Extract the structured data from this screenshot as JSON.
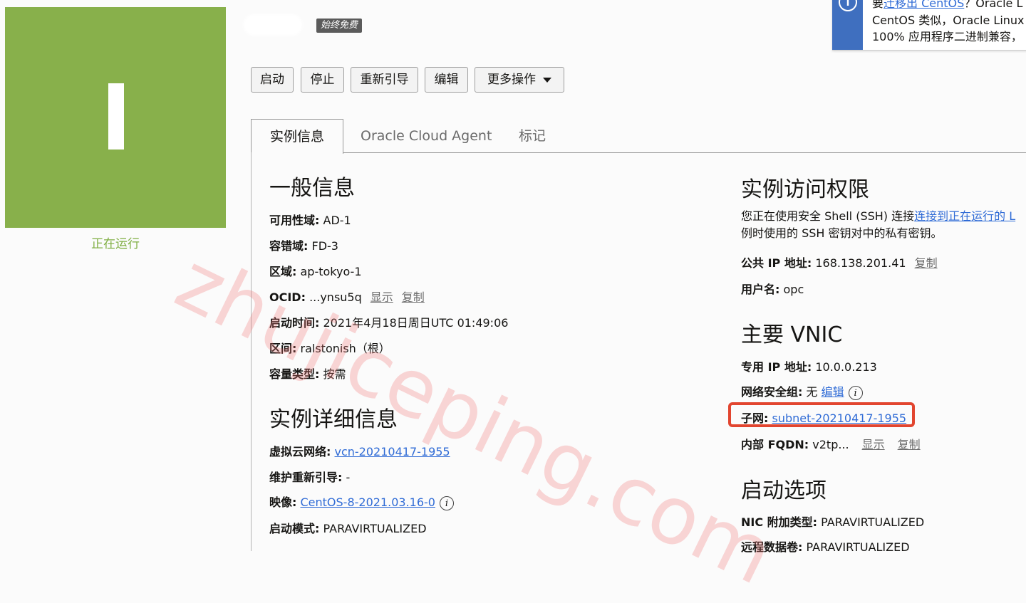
{
  "status": {
    "label": "正在运行",
    "color": "#88b04b"
  },
  "header": {
    "badge": "始终免费"
  },
  "banner": {
    "line1_prefix": "要",
    "line1_link": "迁移出 CentOS",
    "line1_suffix": "？Oracle L",
    "line2": "CentOS 类似，Oracle Linux",
    "line3": "100% 应用程序二进制兼容，"
  },
  "actions": {
    "start": "启动",
    "stop": "停止",
    "reboot": "重新引导",
    "edit": "编辑",
    "more": "更多操作"
  },
  "tabs": [
    "实例信息",
    "Oracle Cloud Agent",
    "标记"
  ],
  "general": {
    "title": "一般信息",
    "ad_label": "可用性域:",
    "ad_value": "AD-1",
    "fd_label": "容错域:",
    "fd_value": "FD-3",
    "region_label": "区域:",
    "region_value": "ap-tokyo-1",
    "ocid_label": "OCID:",
    "ocid_value": "...ynsu5q",
    "ocid_show": "显示",
    "ocid_copy": "复制",
    "launch_label": "启动时间:",
    "launch_value": "2021年4月18日周日UTC 01:49:06",
    "compartment_label": "区间:",
    "compartment_value": "ralstonish（根）",
    "capacity_label": "容量类型:",
    "capacity_value": "按需"
  },
  "details": {
    "title": "实例详细信息",
    "vcn_label": "虚拟云网络:",
    "vcn_value": "vcn-20210417-1955",
    "maint_label": "维护重新引导:",
    "maint_value": "-",
    "image_label": "映像:",
    "image_value": "CentOS-8-2021.03.16-0",
    "launch_mode_label": "启动模式:",
    "launch_mode_value": "PARAVIRTUALIZED"
  },
  "access": {
    "title": "实例访问权限",
    "desc1_prefix": "您正在使用安全 Shell (SSH) 连接",
    "desc1_link": "连接到正在运行的 L",
    "desc2": "例时使用的 SSH 密钥对中的私有密钥。",
    "public_ip_label": "公共 IP 地址:",
    "public_ip_value": "168.138.201.41",
    "public_ip_copy": "复制",
    "username_label": "用户名:",
    "username_value": "opc"
  },
  "vnic": {
    "title": "主要 VNIC",
    "private_ip_label": "专用 IP 地址:",
    "private_ip_value": "10.0.0.213",
    "nsg_label": "网络安全组:",
    "nsg_value": "无",
    "nsg_edit": "编辑",
    "subnet_label": "子网:",
    "subnet_value": "subnet-20210417-1955",
    "fqdn_label": "内部 FQDN:",
    "fqdn_value": "v2tp...",
    "fqdn_show": "显示",
    "fqdn_copy": "复制"
  },
  "launch_options": {
    "title": "启动选项",
    "nic_label": "NIC 附加类型:",
    "nic_value": "PARAVIRTUALIZED",
    "remote_label": "远程数据卷:",
    "remote_value": "PARAVIRTUALIZED"
  },
  "watermark": "zhujiceping.com"
}
